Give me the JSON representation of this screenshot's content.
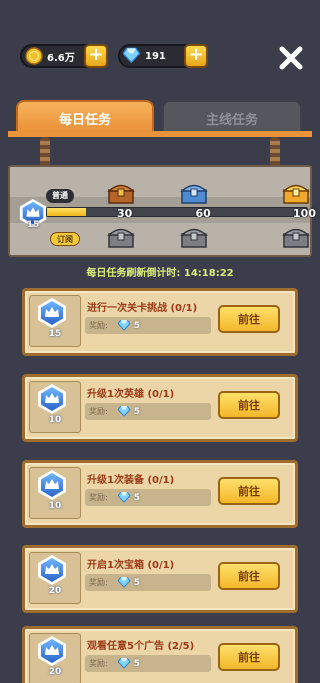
{
  "currency": {
    "gold": {
      "value": "6.6万",
      "icon": "gold-coin-icon"
    },
    "gems": {
      "value": "191",
      "icon": "diamond-icon"
    },
    "plus_symbol": "+"
  },
  "tabs": [
    {
      "label": "每日任务",
      "active": true
    },
    {
      "label": "主线任务",
      "active": false
    }
  ],
  "progress": {
    "level": "15",
    "free_label": "普通",
    "subscribe_label": "订阅",
    "current_points": 15,
    "max_points": 100,
    "milestones": [
      {
        "points": 30,
        "label": "30",
        "free_chest": "bronze-chest-icon",
        "sub_chest": "locked-chest-icon"
      },
      {
        "points": 60,
        "label": "60",
        "free_chest": "silver-chest-icon",
        "sub_chest": "locked-chest-icon"
      },
      {
        "points": 100,
        "label": "100",
        "free_chest": "gold-chest-icon",
        "sub_chest": "locked-chest-icon"
      }
    ]
  },
  "countdown": {
    "label": "每日任务刷新倒计时:",
    "time": "14:18:22"
  },
  "tasks": [
    {
      "title": "进行一次关卡挑战 (0/1)",
      "points": "15",
      "reward_label": "奖励:",
      "reward_amount": "5",
      "button": "前往"
    },
    {
      "title": "升级1次英雄 (0/1)",
      "points": "10",
      "reward_label": "奖励:",
      "reward_amount": "5",
      "button": "前往"
    },
    {
      "title": "升级1次装备 (0/1)",
      "points": "10",
      "reward_label": "奖励:",
      "reward_amount": "5",
      "button": "前往"
    },
    {
      "title": "开启1次宝箱 (0/1)",
      "points": "20",
      "reward_label": "奖励:",
      "reward_amount": "5",
      "button": "前往"
    },
    {
      "title": "观看任意5个广告 (2/5)",
      "points": "20",
      "reward_label": "奖励:",
      "reward_amount": "5",
      "button": "前往"
    }
  ],
  "colors": {
    "accent": "#e98f36",
    "button": "#f3b72a",
    "card": "#ecd6a8"
  }
}
